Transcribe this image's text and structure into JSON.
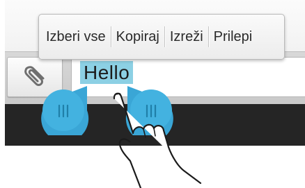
{
  "menu": {
    "items": [
      {
        "label": "Izberi vse"
      },
      {
        "label": "Kopiraj"
      },
      {
        "label": "Izreži"
      },
      {
        "label": "Prilepi"
      }
    ]
  },
  "input": {
    "text": "Hello",
    "attach_icon": "paperclip-icon"
  },
  "colors": {
    "selection": "#8cd0e4",
    "handle": "#3aa6d6",
    "dark_bar": "#252525"
  }
}
